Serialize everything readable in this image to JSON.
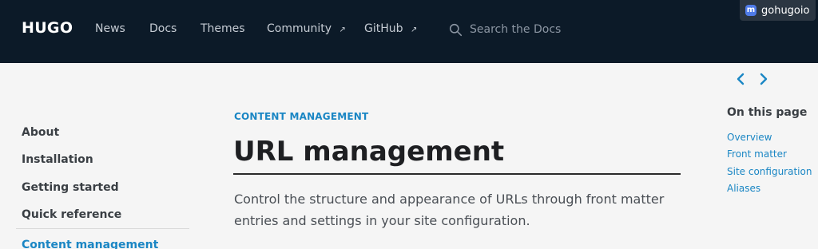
{
  "header": {
    "brand": "HUGO",
    "nav": [
      {
        "label": "News",
        "external": false
      },
      {
        "label": "Docs",
        "external": false
      },
      {
        "label": "Themes",
        "external": false
      },
      {
        "label": "Community",
        "external": true
      },
      {
        "label": "GitHub",
        "external": true
      }
    ],
    "search_placeholder": "Search the Docs",
    "mastodon_handle": "gohugoio",
    "mastodon_icon_letter": "m"
  },
  "sidebar": {
    "items": [
      {
        "label": "About",
        "active": false
      },
      {
        "label": "Installation",
        "active": false
      },
      {
        "label": "Getting started",
        "active": false
      },
      {
        "label": "Quick reference",
        "active": false
      },
      {
        "label": "Content management",
        "active": true
      }
    ]
  },
  "main": {
    "section": "CONTENT MANAGEMENT",
    "title": "URL management",
    "lead": "Control the structure and appearance of URLs through front matter entries and settings in your site configuration."
  },
  "toc": {
    "heading": "On this page",
    "links": [
      "Overview",
      "Front matter",
      "Site configuration",
      "Aliases"
    ]
  },
  "colors": {
    "header_bg": "#0c1a28",
    "accent": "#1a86c4",
    "page_bg": "#f5f5f5"
  }
}
